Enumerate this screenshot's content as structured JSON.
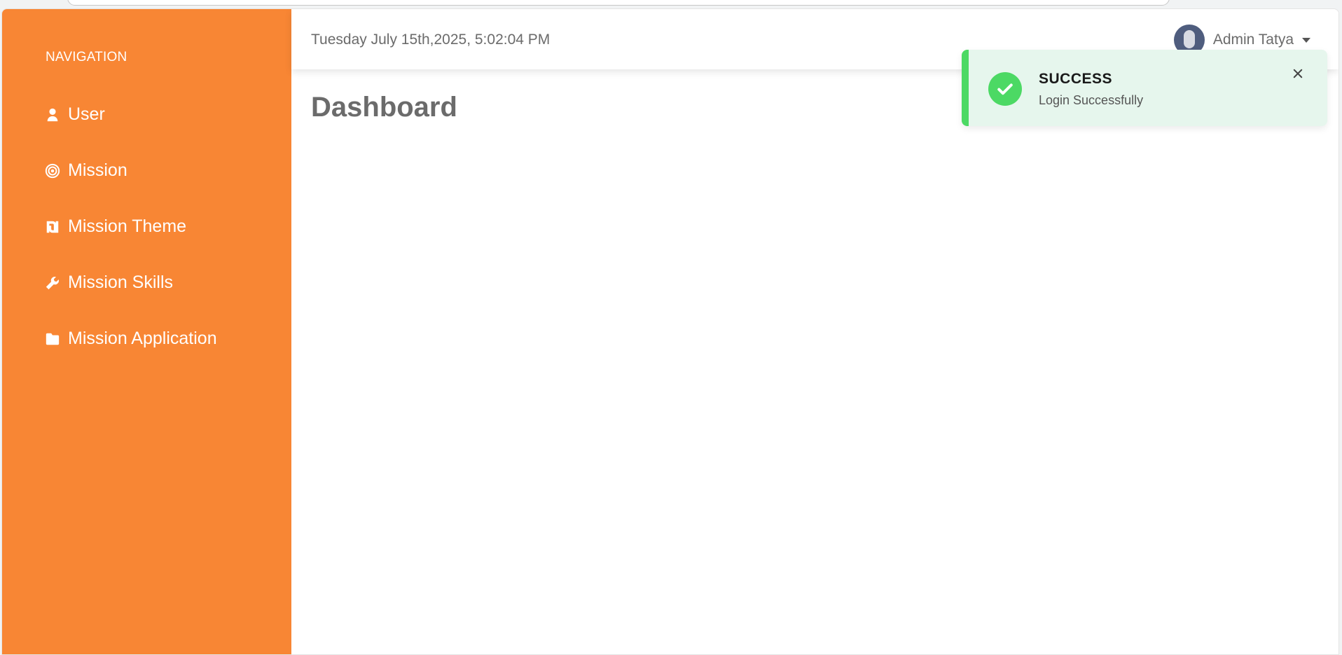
{
  "sidebar": {
    "heading": "NAVIGATION",
    "items": [
      {
        "label": "User",
        "icon": "user-icon"
      },
      {
        "label": "Mission",
        "icon": "target-icon"
      },
      {
        "label": "Mission Theme",
        "icon": "sheqel-icon"
      },
      {
        "label": "Mission Skills",
        "icon": "wrench-icon"
      },
      {
        "label": "Mission Application",
        "icon": "folder-icon"
      }
    ]
  },
  "header": {
    "datetime": "Tuesday July 15th,2025, 5:02:04 PM",
    "user_name": "Admin Tatya"
  },
  "main": {
    "title": "Dashboard"
  },
  "toast": {
    "title": "SUCCESS",
    "message": "Login Successfully",
    "icon": "check-circle-icon"
  },
  "colors": {
    "sidebar_bg": "#f88634",
    "toast_accent": "#4cd964",
    "toast_bg": "#e6f6ed",
    "avatar_bg": "#4f5d7e"
  }
}
